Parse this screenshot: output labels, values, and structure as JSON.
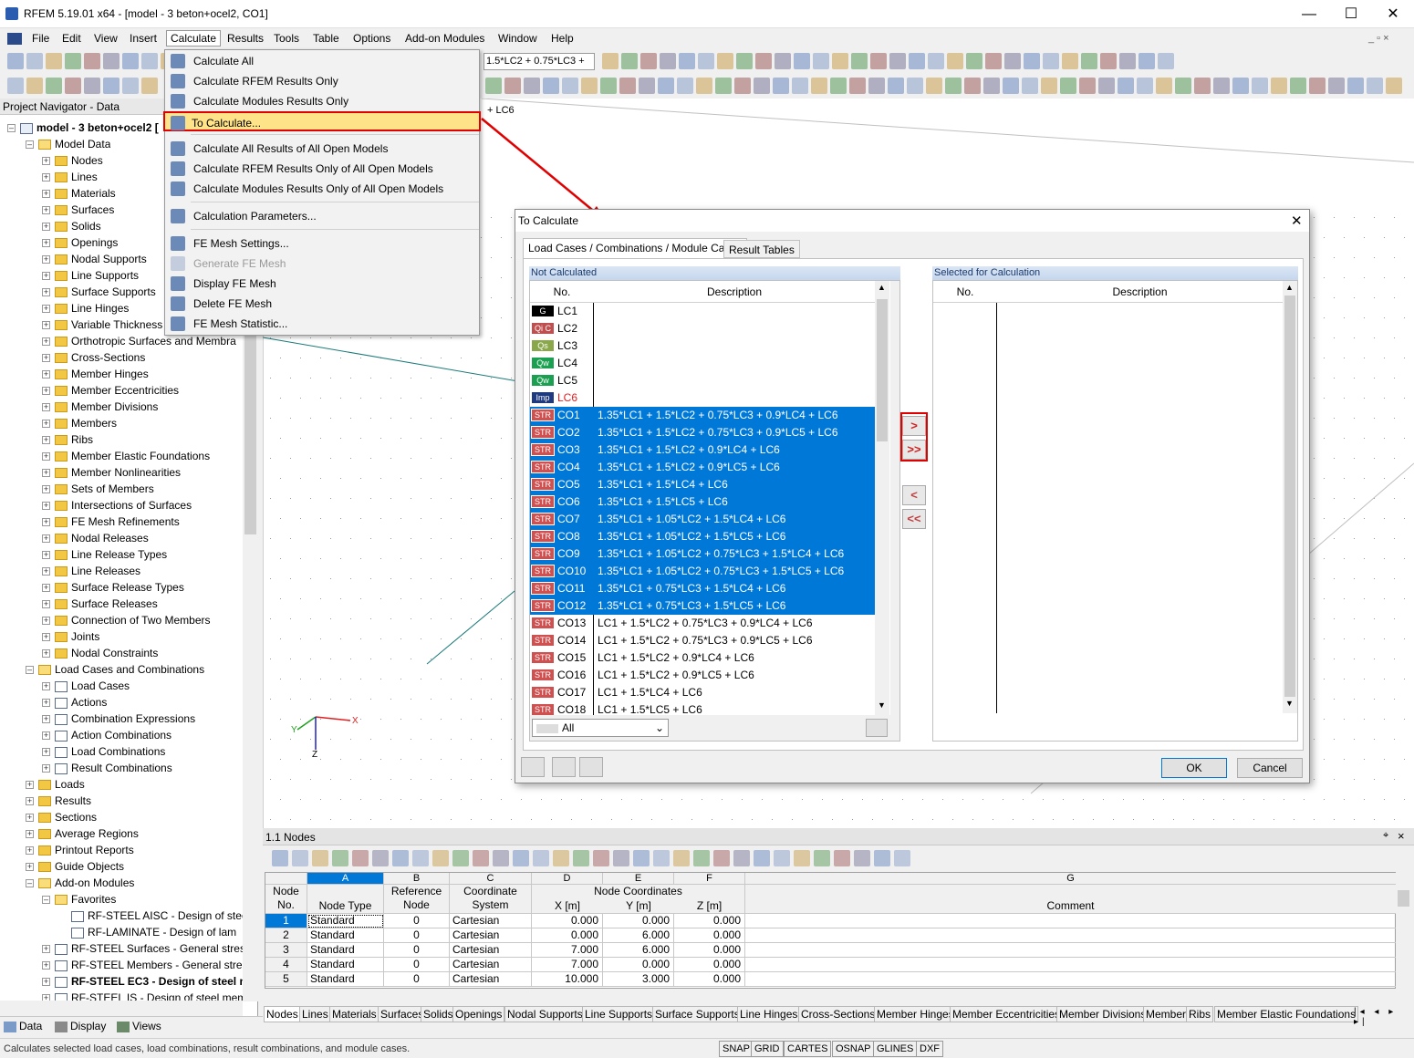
{
  "window": {
    "title": "RFEM 5.19.01 x64 - [model - 3 beton+ocel2, CO1]"
  },
  "menubar": [
    "File",
    "Edit",
    "View",
    "Insert",
    "Calculate",
    "Results",
    "Tools",
    "Table",
    "Options",
    "Add-on Modules",
    "Window",
    "Help"
  ],
  "toolbar": {
    "combo_value": "1.5*LC2 + 0.75*LC3 +"
  },
  "navigator": {
    "title": "Project Navigator - Data",
    "model": "model - 3 beton+ocel2 [",
    "items": [
      {
        "label": "Model Data",
        "lvl": 1,
        "t": "o"
      },
      {
        "label": "Nodes",
        "lvl": 2,
        "t": "f"
      },
      {
        "label": "Lines",
        "lvl": 2,
        "t": "f"
      },
      {
        "label": "Materials",
        "lvl": 2,
        "t": "f"
      },
      {
        "label": "Surfaces",
        "lvl": 2,
        "t": "f"
      },
      {
        "label": "Solids",
        "lvl": 2,
        "t": "f"
      },
      {
        "label": "Openings",
        "lvl": 2,
        "t": "f"
      },
      {
        "label": "Nodal Supports",
        "lvl": 2,
        "t": "f"
      },
      {
        "label": "Line Supports",
        "lvl": 2,
        "t": "f"
      },
      {
        "label": "Surface Supports",
        "lvl": 2,
        "t": "f"
      },
      {
        "label": "Line Hinges",
        "lvl": 2,
        "t": "f"
      },
      {
        "label": "Variable Thickness",
        "lvl": 2,
        "t": "f"
      },
      {
        "label": "Orthotropic Surfaces and Membra",
        "lvl": 2,
        "t": "f"
      },
      {
        "label": "Cross-Sections",
        "lvl": 2,
        "t": "f"
      },
      {
        "label": "Member Hinges",
        "lvl": 2,
        "t": "f"
      },
      {
        "label": "Member Eccentricities",
        "lvl": 2,
        "t": "f"
      },
      {
        "label": "Member Divisions",
        "lvl": 2,
        "t": "f"
      },
      {
        "label": "Members",
        "lvl": 2,
        "t": "f"
      },
      {
        "label": "Ribs",
        "lvl": 2,
        "t": "f"
      },
      {
        "label": "Member Elastic Foundations",
        "lvl": 2,
        "t": "f"
      },
      {
        "label": "Member Nonlinearities",
        "lvl": 2,
        "t": "f"
      },
      {
        "label": "Sets of Members",
        "lvl": 2,
        "t": "f"
      },
      {
        "label": "Intersections of Surfaces",
        "lvl": 2,
        "t": "f"
      },
      {
        "label": "FE Mesh Refinements",
        "lvl": 2,
        "t": "f"
      },
      {
        "label": "Nodal Releases",
        "lvl": 2,
        "t": "f"
      },
      {
        "label": "Line Release Types",
        "lvl": 2,
        "t": "f"
      },
      {
        "label": "Line Releases",
        "lvl": 2,
        "t": "f"
      },
      {
        "label": "Surface Release Types",
        "lvl": 2,
        "t": "f"
      },
      {
        "label": "Surface Releases",
        "lvl": 2,
        "t": "f"
      },
      {
        "label": "Connection of Two Members",
        "lvl": 2,
        "t": "f"
      },
      {
        "label": "Joints",
        "lvl": 2,
        "t": "f"
      },
      {
        "label": "Nodal Constraints",
        "lvl": 2,
        "t": "f"
      },
      {
        "label": "Load Cases and Combinations",
        "lvl": 1,
        "t": "o"
      },
      {
        "label": "Load Cases",
        "lvl": 2,
        "t": "g"
      },
      {
        "label": "Actions",
        "lvl": 2,
        "t": "g"
      },
      {
        "label": "Combination Expressions",
        "lvl": 2,
        "t": "g"
      },
      {
        "label": "Action Combinations",
        "lvl": 2,
        "t": "g"
      },
      {
        "label": "Load Combinations",
        "lvl": 2,
        "t": "g"
      },
      {
        "label": "Result Combinations",
        "lvl": 2,
        "t": "g"
      },
      {
        "label": "Loads",
        "lvl": 1,
        "t": "f"
      },
      {
        "label": "Results",
        "lvl": 1,
        "t": "f"
      },
      {
        "label": "Sections",
        "lvl": 1,
        "t": "f"
      },
      {
        "label": "Average Regions",
        "lvl": 1,
        "t": "f"
      },
      {
        "label": "Printout Reports",
        "lvl": 1,
        "t": "f"
      },
      {
        "label": "Guide Objects",
        "lvl": 1,
        "t": "f"
      },
      {
        "label": "Add-on Modules",
        "lvl": 1,
        "t": "o"
      },
      {
        "label": "Favorites",
        "lvl": 2,
        "t": "o"
      },
      {
        "label": "RF-STEEL AISC - Design of stee",
        "lvl": 3,
        "t": "g"
      },
      {
        "label": "RF-LAMINATE - Design of lam",
        "lvl": 3,
        "t": "g"
      },
      {
        "label": "RF-STEEL Surfaces - General stress",
        "lvl": 2,
        "t": "g"
      },
      {
        "label": "RF-STEEL Members - General stres",
        "lvl": 2,
        "t": "g"
      },
      {
        "label": "RF-STEEL EC3 - Design of steel m",
        "lvl": 2,
        "t": "g"
      },
      {
        "label": "RF-STEEL IS - Design of steel mem",
        "lvl": 2,
        "t": "g"
      }
    ],
    "tabs": [
      "Data",
      "Display",
      "Views"
    ]
  },
  "calc_menu": {
    "items": [
      {
        "label": "Calculate All",
        "sep_after": false,
        "disabled": false
      },
      {
        "label": "Calculate RFEM Results Only",
        "sep_after": false,
        "disabled": false
      },
      {
        "label": "Calculate Modules Results Only",
        "sep_after": false,
        "disabled": false
      },
      {
        "label": "To Calculate...",
        "sep_after": true,
        "disabled": false,
        "highlight": true
      },
      {
        "label": "Calculate All Results of All Open Models",
        "sep_after": false,
        "disabled": false
      },
      {
        "label": "Calculate RFEM Results Only of All Open Models",
        "sep_after": false,
        "disabled": false
      },
      {
        "label": "Calculate Modules Results Only of All Open Models",
        "sep_after": true,
        "disabled": false
      },
      {
        "label": "Calculation Parameters...",
        "sep_after": true,
        "disabled": false
      },
      {
        "label": "FE Mesh Settings...",
        "sep_after": false,
        "disabled": false
      },
      {
        "label": "Generate FE Mesh",
        "sep_after": false,
        "disabled": true
      },
      {
        "label": "Display FE Mesh",
        "sep_after": false,
        "disabled": false
      },
      {
        "label": "Delete FE Mesh",
        "sep_after": false,
        "disabled": false
      },
      {
        "label": "FE Mesh Statistic...",
        "sep_after": false,
        "disabled": false
      }
    ]
  },
  "view": {
    "label_lc6": "+ LC6",
    "axis_x": "X",
    "axis_y": "Y",
    "axis_z": "Z"
  },
  "dialog": {
    "title": "To Calculate",
    "tabs": [
      "Load Cases / Combinations / Module Cases",
      "Result Tables"
    ],
    "left_title": "Not Calculated",
    "right_title": "Selected for Calculation",
    "col_no": "No.",
    "col_desc": "Description",
    "filter": "All",
    "ok": "OK",
    "cancel": "Cancel",
    "rows": [
      {
        "badge": "G",
        "color": "#000000",
        "no": "LC1",
        "desc": "",
        "sel": false
      },
      {
        "badge": "Qi C",
        "color": "#c05050",
        "no": "LC2",
        "desc": "",
        "sel": false
      },
      {
        "badge": "Qs",
        "color": "#8aa84a",
        "no": "LC3",
        "desc": "",
        "sel": false
      },
      {
        "badge": "Qw",
        "color": "#1aa050",
        "no": "LC4",
        "desc": "",
        "sel": false
      },
      {
        "badge": "Qw",
        "color": "#1aa050",
        "no": "LC5",
        "desc": "",
        "sel": false
      },
      {
        "badge": "Imp",
        "color": "#203a80",
        "no": "LC6",
        "desc": "",
        "sel": false,
        "red": true
      },
      {
        "badge": "STR",
        "color": "#d05050",
        "no": "CO1",
        "desc": "1.35*LC1 + 1.5*LC2 + 0.75*LC3 + 0.9*LC4 + LC6",
        "sel": true
      },
      {
        "badge": "STR",
        "color": "#d05050",
        "no": "CO2",
        "desc": "1.35*LC1 + 1.5*LC2 + 0.75*LC3 + 0.9*LC5 + LC6",
        "sel": true
      },
      {
        "badge": "STR",
        "color": "#d05050",
        "no": "CO3",
        "desc": "1.35*LC1 + 1.5*LC2 + 0.9*LC4 + LC6",
        "sel": true
      },
      {
        "badge": "STR",
        "color": "#d05050",
        "no": "CO4",
        "desc": "1.35*LC1 + 1.5*LC2 + 0.9*LC5 + LC6",
        "sel": true
      },
      {
        "badge": "STR",
        "color": "#d05050",
        "no": "CO5",
        "desc": "1.35*LC1 + 1.5*LC4 + LC6",
        "sel": true
      },
      {
        "badge": "STR",
        "color": "#d05050",
        "no": "CO6",
        "desc": "1.35*LC1 + 1.5*LC5 + LC6",
        "sel": true
      },
      {
        "badge": "STR",
        "color": "#d05050",
        "no": "CO7",
        "desc": "1.35*LC1 + 1.05*LC2 + 1.5*LC4 + LC6",
        "sel": true
      },
      {
        "badge": "STR",
        "color": "#d05050",
        "no": "CO8",
        "desc": "1.35*LC1 + 1.05*LC2 + 1.5*LC5 + LC6",
        "sel": true
      },
      {
        "badge": "STR",
        "color": "#d05050",
        "no": "CO9",
        "desc": "1.35*LC1 + 1.05*LC2 + 0.75*LC3 + 1.5*LC4 + LC6",
        "sel": true
      },
      {
        "badge": "STR",
        "color": "#d05050",
        "no": "CO10",
        "desc": "1.35*LC1 + 1.05*LC2 + 0.75*LC3 + 1.5*LC5 + LC6",
        "sel": true
      },
      {
        "badge": "STR",
        "color": "#d05050",
        "no": "CO11",
        "desc": "1.35*LC1 + 0.75*LC3 + 1.5*LC4 + LC6",
        "sel": true
      },
      {
        "badge": "STR",
        "color": "#d05050",
        "no": "CO12",
        "desc": "1.35*LC1 + 0.75*LC3 + 1.5*LC5 + LC6",
        "sel": true
      },
      {
        "badge": "STR",
        "color": "#d05050",
        "no": "CO13",
        "desc": "LC1 + 1.5*LC2 + 0.75*LC3 + 0.9*LC4 + LC6",
        "sel": false
      },
      {
        "badge": "STR",
        "color": "#d05050",
        "no": "CO14",
        "desc": "LC1 + 1.5*LC2 + 0.75*LC3 + 0.9*LC5 + LC6",
        "sel": false
      },
      {
        "badge": "STR",
        "color": "#d05050",
        "no": "CO15",
        "desc": "LC1 + 1.5*LC2 + 0.9*LC4 + LC6",
        "sel": false
      },
      {
        "badge": "STR",
        "color": "#d05050",
        "no": "CO16",
        "desc": "LC1 + 1.5*LC2 + 0.9*LC5 + LC6",
        "sel": false
      },
      {
        "badge": "STR",
        "color": "#d05050",
        "no": "CO17",
        "desc": "LC1 + 1.5*LC4 + LC6",
        "sel": false
      },
      {
        "badge": "STR",
        "color": "#d05050",
        "no": "CO18",
        "desc": "LC1 + 1.5*LC5 + LC6",
        "sel": false
      }
    ]
  },
  "table": {
    "title": "1.1 Nodes",
    "col_letters": [
      "A",
      "B",
      "C",
      "D",
      "E",
      "F",
      "G"
    ],
    "h_node": "Node",
    "h_no": "No.",
    "h_type": "Node Type",
    "h_ref1": "Reference",
    "h_ref2": "Node",
    "h_cs1": "Coordinate",
    "h_cs2": "System",
    "h_coords": "Node Coordinates",
    "h_x": "X [m]",
    "h_y": "Y [m]",
    "h_z": "Z [m]",
    "h_comment": "Comment",
    "rows": [
      {
        "no": "1",
        "type": "Standard",
        "ref": "0",
        "cs": "Cartesian",
        "x": "0.000",
        "y": "0.000",
        "z": "0.000"
      },
      {
        "no": "2",
        "type": "Standard",
        "ref": "0",
        "cs": "Cartesian",
        "x": "0.000",
        "y": "6.000",
        "z": "0.000"
      },
      {
        "no": "3",
        "type": "Standard",
        "ref": "0",
        "cs": "Cartesian",
        "x": "7.000",
        "y": "6.000",
        "z": "0.000"
      },
      {
        "no": "4",
        "type": "Standard",
        "ref": "0",
        "cs": "Cartesian",
        "x": "7.000",
        "y": "0.000",
        "z": "0.000"
      },
      {
        "no": "5",
        "type": "Standard",
        "ref": "0",
        "cs": "Cartesian",
        "x": "10.000",
        "y": "3.000",
        "z": "0.000"
      }
    ],
    "tabs": [
      "Nodes",
      "Lines",
      "Materials",
      "Surfaces",
      "Solids",
      "Openings",
      "Nodal Supports",
      "Line Supports",
      "Surface Supports",
      "Line Hinges",
      "Cross-Sections",
      "Member Hinges",
      "Member Eccentricities",
      "Member Divisions",
      "Members",
      "Ribs",
      "Member Elastic Foundations"
    ]
  },
  "status": {
    "text": "Calculates selected load cases, load combinations, result combinations, and module cases.",
    "buttons": [
      "SNAP",
      "GRID",
      "CARTES",
      "OSNAP",
      "GLINES",
      "DXF"
    ]
  }
}
